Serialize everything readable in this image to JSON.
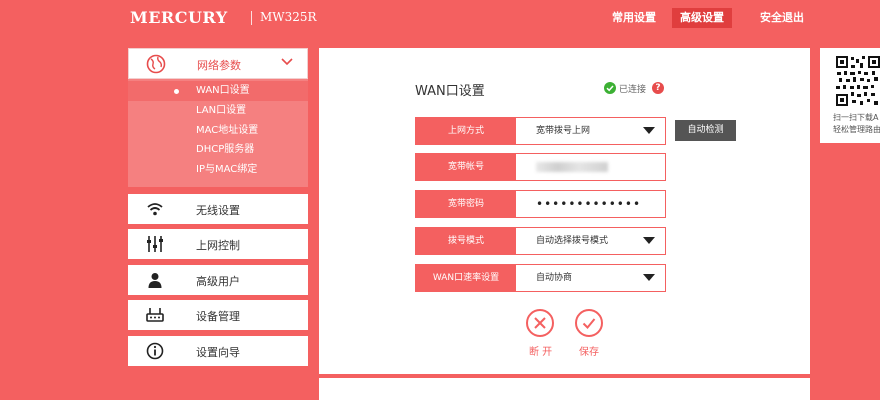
{
  "header": {
    "brand": "MERCURY",
    "model": "MW325R",
    "nav": [
      "常用设置",
      "高级设置",
      "安全退出"
    ],
    "active_nav": "高级设置"
  },
  "sidebar": {
    "network_section": {
      "label": "网络参数",
      "icon": "globe-icon",
      "expanded": true,
      "items": [
        "WAN口设置",
        "LAN口设置",
        "MAC地址设置",
        "DHCP服务器",
        "IP与MAC绑定"
      ],
      "active_item": "WAN口设置"
    },
    "items": [
      {
        "label": "无线设置",
        "icon": "wifi-icon"
      },
      {
        "label": "上网控制",
        "icon": "sliders-icon"
      },
      {
        "label": "高级用户",
        "icon": "user-icon"
      },
      {
        "label": "设备管理",
        "icon": "router-icon"
      },
      {
        "label": "设置向导",
        "icon": "info-icon"
      }
    ]
  },
  "main": {
    "title": "WAN口设置",
    "status_text": "已连接",
    "help": "?",
    "fields": [
      {
        "label": "上网方式",
        "value": "宽带拨号上网",
        "type": "select"
      },
      {
        "label": "宽带帐号",
        "value": "",
        "type": "text-blurred"
      },
      {
        "label": "宽带密码",
        "value": "•••••••••••••",
        "type": "password"
      },
      {
        "label": "拨号模式",
        "value": "自动选择拨号模式",
        "type": "select"
      },
      {
        "label": "WAN口速率设置",
        "value": "自动协商",
        "type": "select"
      }
    ],
    "auto_detect_label": "自动检测",
    "disconnect_label": "断 开",
    "save_label": "保存"
  },
  "qr_panel": {
    "line1": "扫一扫下载A",
    "line2": "轻松管理路由"
  },
  "colors": {
    "brand_red": "#f46060",
    "active_nav_bg": "#e03e3e",
    "submenu_bg": "#f58080",
    "status_green": "#3cb034",
    "auto_button_bg": "#555555"
  }
}
